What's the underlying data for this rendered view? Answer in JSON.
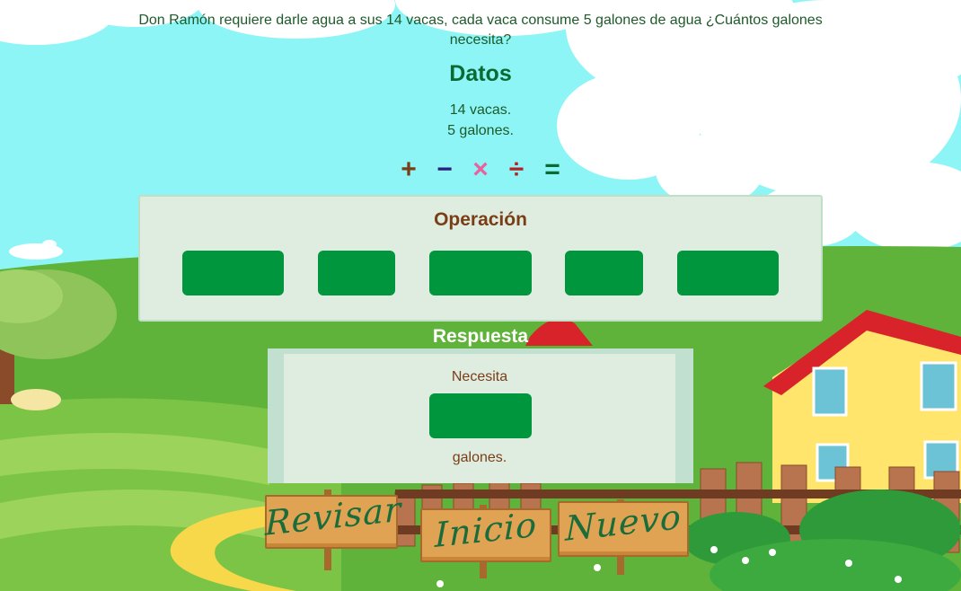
{
  "question": "Don Ramón requiere darle agua a sus 14 vacas, cada vaca consume 5 galones de agua ¿Cuántos galones necesita?",
  "datos": {
    "title": "Datos",
    "items": [
      "14 vacas.",
      "5 galones."
    ]
  },
  "operators": [
    {
      "symbol": "+",
      "name": "plus",
      "color": "#7a3e17"
    },
    {
      "symbol": "−",
      "name": "minus",
      "color": "#2c1f7a"
    },
    {
      "symbol": "×",
      "name": "multiply",
      "color": "#e8629e"
    },
    {
      "symbol": "÷",
      "name": "divide",
      "color": "#b32126"
    },
    {
      "symbol": "=",
      "name": "equals",
      "color": "#0a6a34"
    }
  ],
  "operation": {
    "title": "Operación",
    "slots": [
      "",
      "",
      "",
      "",
      ""
    ]
  },
  "answer": {
    "title": "Respuesta",
    "before": "Necesita",
    "value": "",
    "after": "galones."
  },
  "buttons": {
    "revisar": "Revisar",
    "inicio": "Inicio",
    "nuevo": "Nuevo"
  },
  "colors": {
    "slot": "#00963e",
    "panel": "#dfede1",
    "grass": "#5fb33a",
    "sky": "#8ef5f7"
  }
}
